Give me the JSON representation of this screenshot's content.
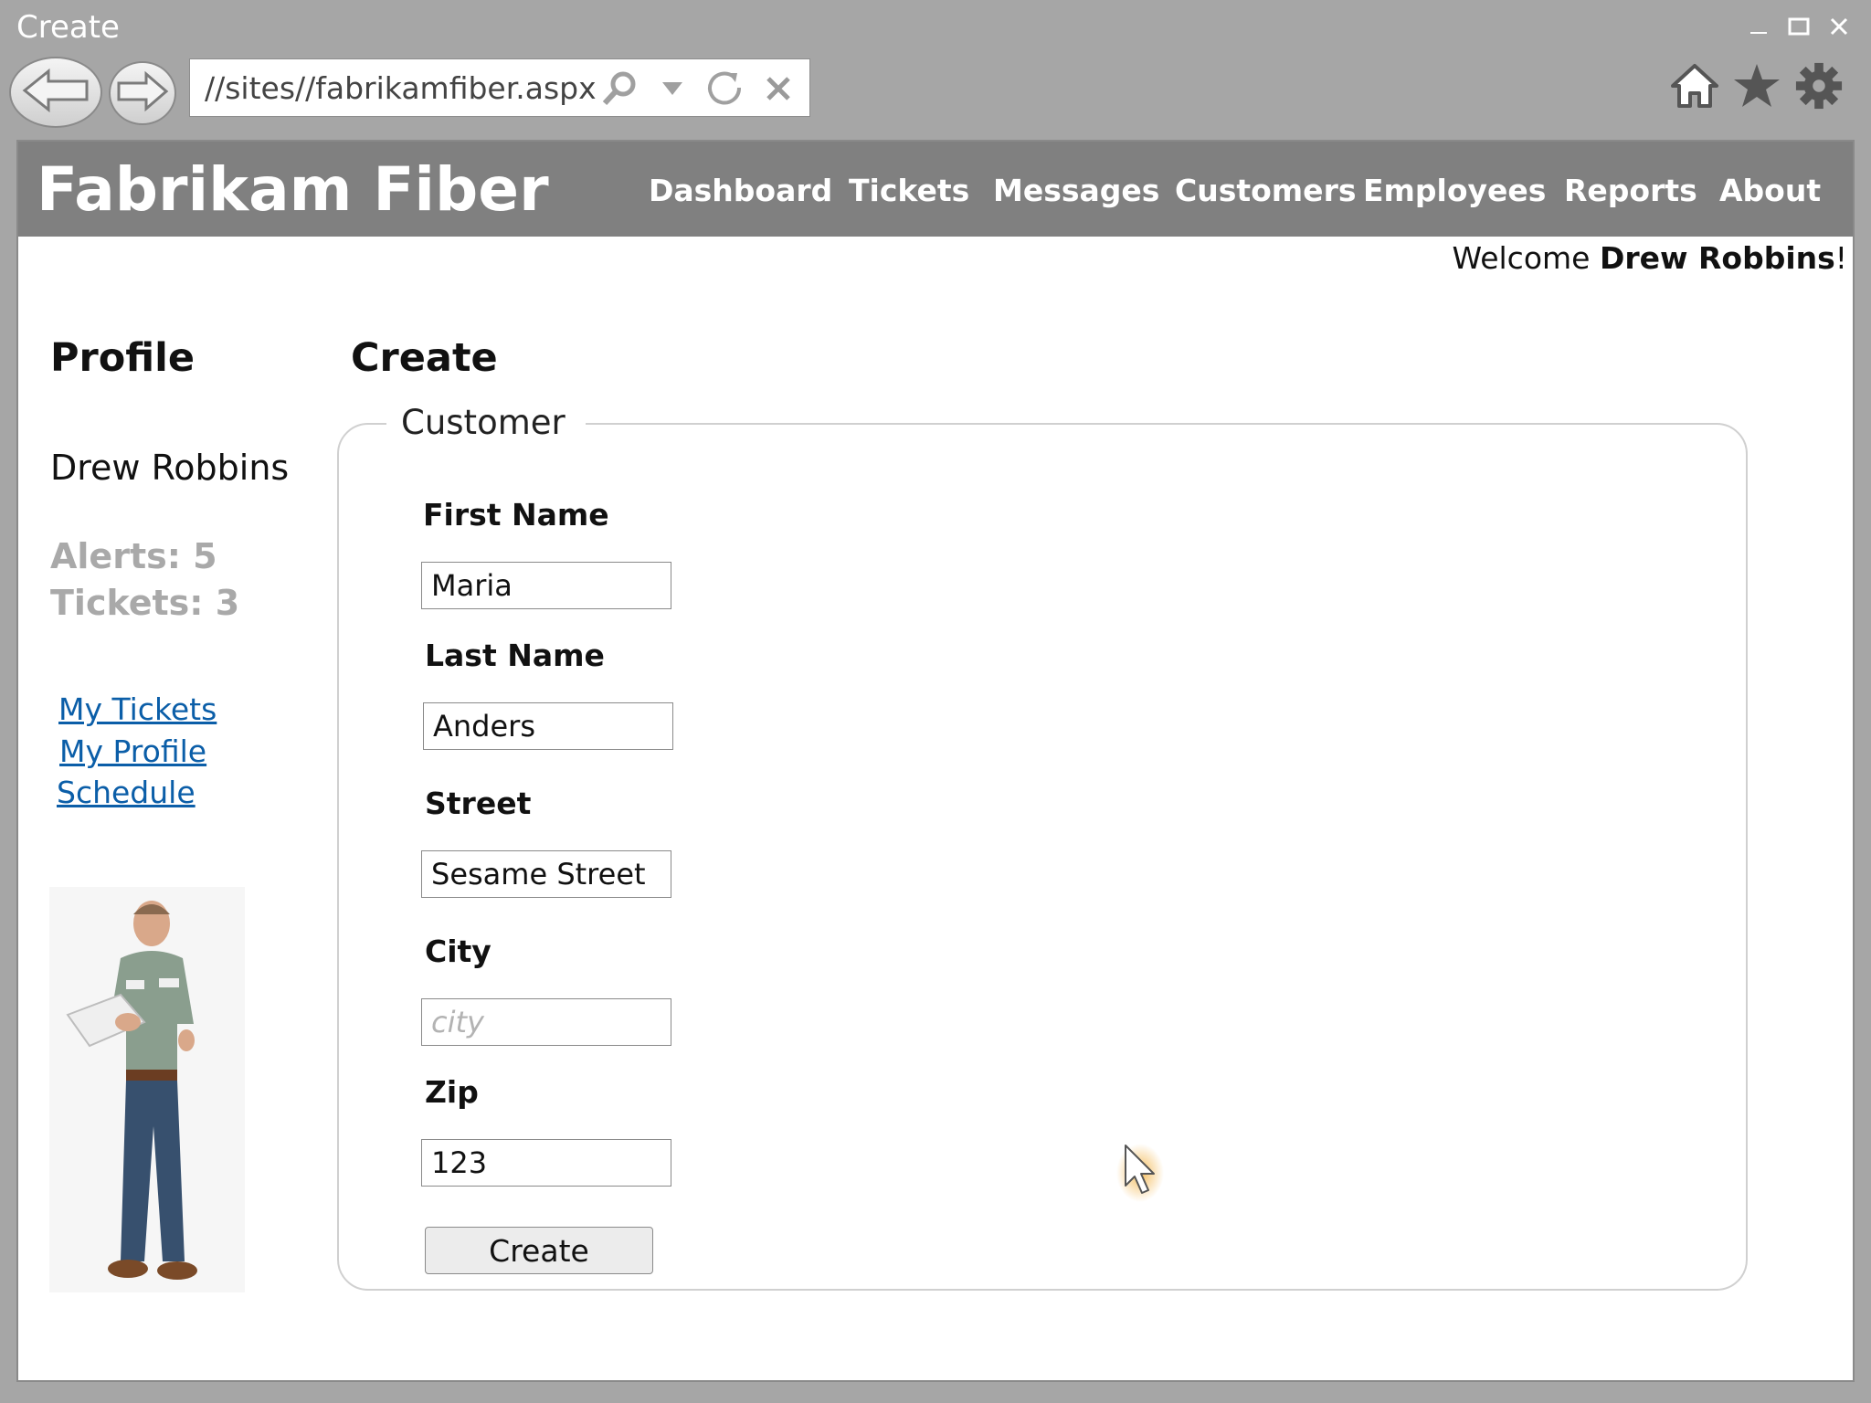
{
  "window": {
    "title": "Create"
  },
  "browser": {
    "url": "//sites//fabrikamfiber.aspx",
    "icons": [
      "back-arrow-icon",
      "forward-arrow-icon",
      "search-icon",
      "dropdown-icon",
      "refresh-icon",
      "close-icon",
      "home-icon",
      "star-icon",
      "gear-icon"
    ]
  },
  "site": {
    "brand": "Fabrikam Fiber",
    "nav": [
      "Dashboard",
      "Tickets",
      "Messages",
      "Customers",
      "Employees",
      "Reports",
      "About"
    ],
    "welcome_prefix": "Welcome ",
    "welcome_user": "Drew Robbins",
    "welcome_suffix": "!"
  },
  "sidebar": {
    "title": "Profile",
    "name": "Drew Robbins",
    "alerts": "Alerts: 5",
    "tickets": "Tickets: 3",
    "links": [
      "My Tickets",
      "My Profile",
      "Schedule"
    ]
  },
  "main": {
    "title": "Create",
    "legend": "Customer",
    "fields": {
      "first_name": {
        "label": "First Name",
        "value": "Maria"
      },
      "last_name": {
        "label": "Last Name",
        "value": "Anders"
      },
      "street": {
        "label": "Street",
        "value": "Sesame Street"
      },
      "city": {
        "label": "City",
        "value": "",
        "placeholder": "city"
      },
      "zip": {
        "label": "Zip",
        "value": "123"
      }
    },
    "submit_label": "Create"
  },
  "colors": {
    "chrome": "#a6a6a6",
    "header": "#808080",
    "link": "#0b5ea8",
    "stat": "#a9a9a9"
  }
}
